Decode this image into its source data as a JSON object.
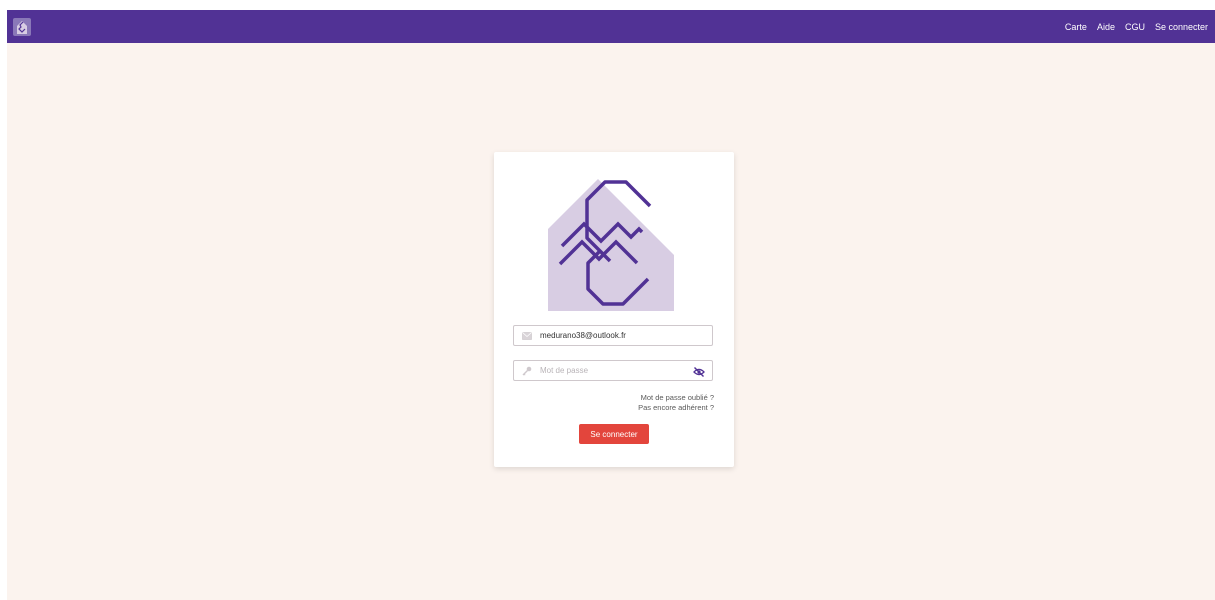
{
  "header": {
    "logo_icon": "app-logo-icon",
    "nav": [
      {
        "label": "Carte"
      },
      {
        "label": "Aide"
      },
      {
        "label": "CGU"
      },
      {
        "label": "Se connecter"
      }
    ]
  },
  "login": {
    "email_value": "medurano38@outlook.fr",
    "email_icon": "envelope-icon",
    "password_placeholder": "Mot de passe",
    "password_icon": "key-icon",
    "toggle_icon": "eye-slash-icon",
    "forgot_label": "Mot de passe oublié ?",
    "signup_label": "Pas encore adhérent ?",
    "submit_label": "Se connecter"
  },
  "colors": {
    "brand": "#513295",
    "background": "#fbf3ee",
    "logo_fill": "#d8cde3",
    "button": "#e3453c"
  }
}
